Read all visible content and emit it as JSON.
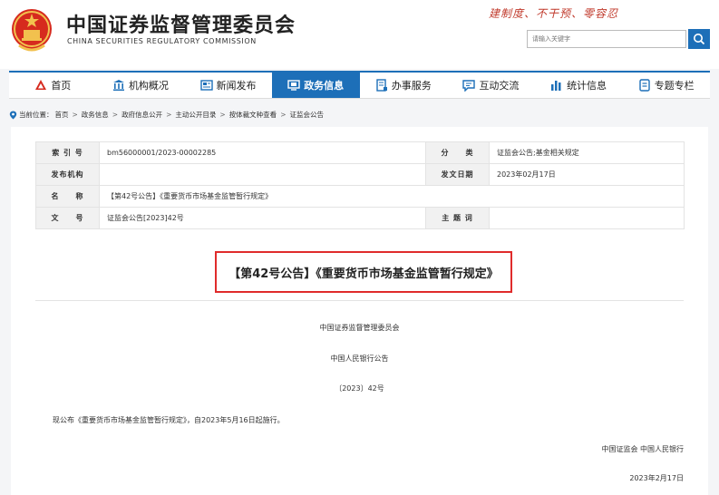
{
  "header": {
    "title": "中国证券监督管理委员会",
    "subtitle": "CHINA SECURITIES REGULATORY COMMISSION",
    "slogan": "建制度、不干预、零容忍",
    "search_placeholder": "请输入关键字"
  },
  "nav": {
    "items": [
      {
        "label": "首页",
        "icon": "home-icon"
      },
      {
        "label": "机构概况",
        "icon": "building-icon"
      },
      {
        "label": "新闻发布",
        "icon": "news-icon"
      },
      {
        "label": "政务信息",
        "icon": "monitor-icon",
        "active": true
      },
      {
        "label": "办事服务",
        "icon": "service-icon"
      },
      {
        "label": "互动交流",
        "icon": "chat-icon"
      },
      {
        "label": "统计信息",
        "icon": "chart-icon"
      },
      {
        "label": "专题专栏",
        "icon": "bookmark-icon"
      }
    ]
  },
  "breadcrumb": {
    "prefix": "当前位置：",
    "items": [
      "首页",
      "政务信息",
      "政府信息公开",
      "主动公开目录",
      "按体裁文种查看",
      "证监会公告"
    ]
  },
  "meta": {
    "index_label": "索 引 号",
    "index_value": "bm56000001/2023-00002285",
    "category_label": "分　　类",
    "category_value": "证监会公告;基金相关规定",
    "issuer_label": "发布机构",
    "issuer_value": "",
    "date_label": "发文日期",
    "date_value": "2023年02月17日",
    "name_label": "名　　称",
    "name_value": "【第42号公告】《重要货币市场基金监管暂行规定》",
    "docno_label": "文　　号",
    "docno_value": "证监会公告[2023]42号",
    "keyword_label": "主 题 词",
    "keyword_value": ""
  },
  "document": {
    "title": "【第42号公告】《重要货币市场基金监管暂行规定》",
    "org1": "中国证券监督管理委员会",
    "org2": "中国人民银行公告",
    "number": "〔2023〕42号",
    "body": "现公布《重要货币市场基金监管暂行规定》，自2023年5月16日起施行。",
    "signature": "中国证监会  中国人民银行",
    "date": "2023年2月17日"
  },
  "colors": {
    "brand_blue": "#1d6fb8",
    "highlight_red": "#e02b2b",
    "slogan_red": "#c0392b"
  }
}
